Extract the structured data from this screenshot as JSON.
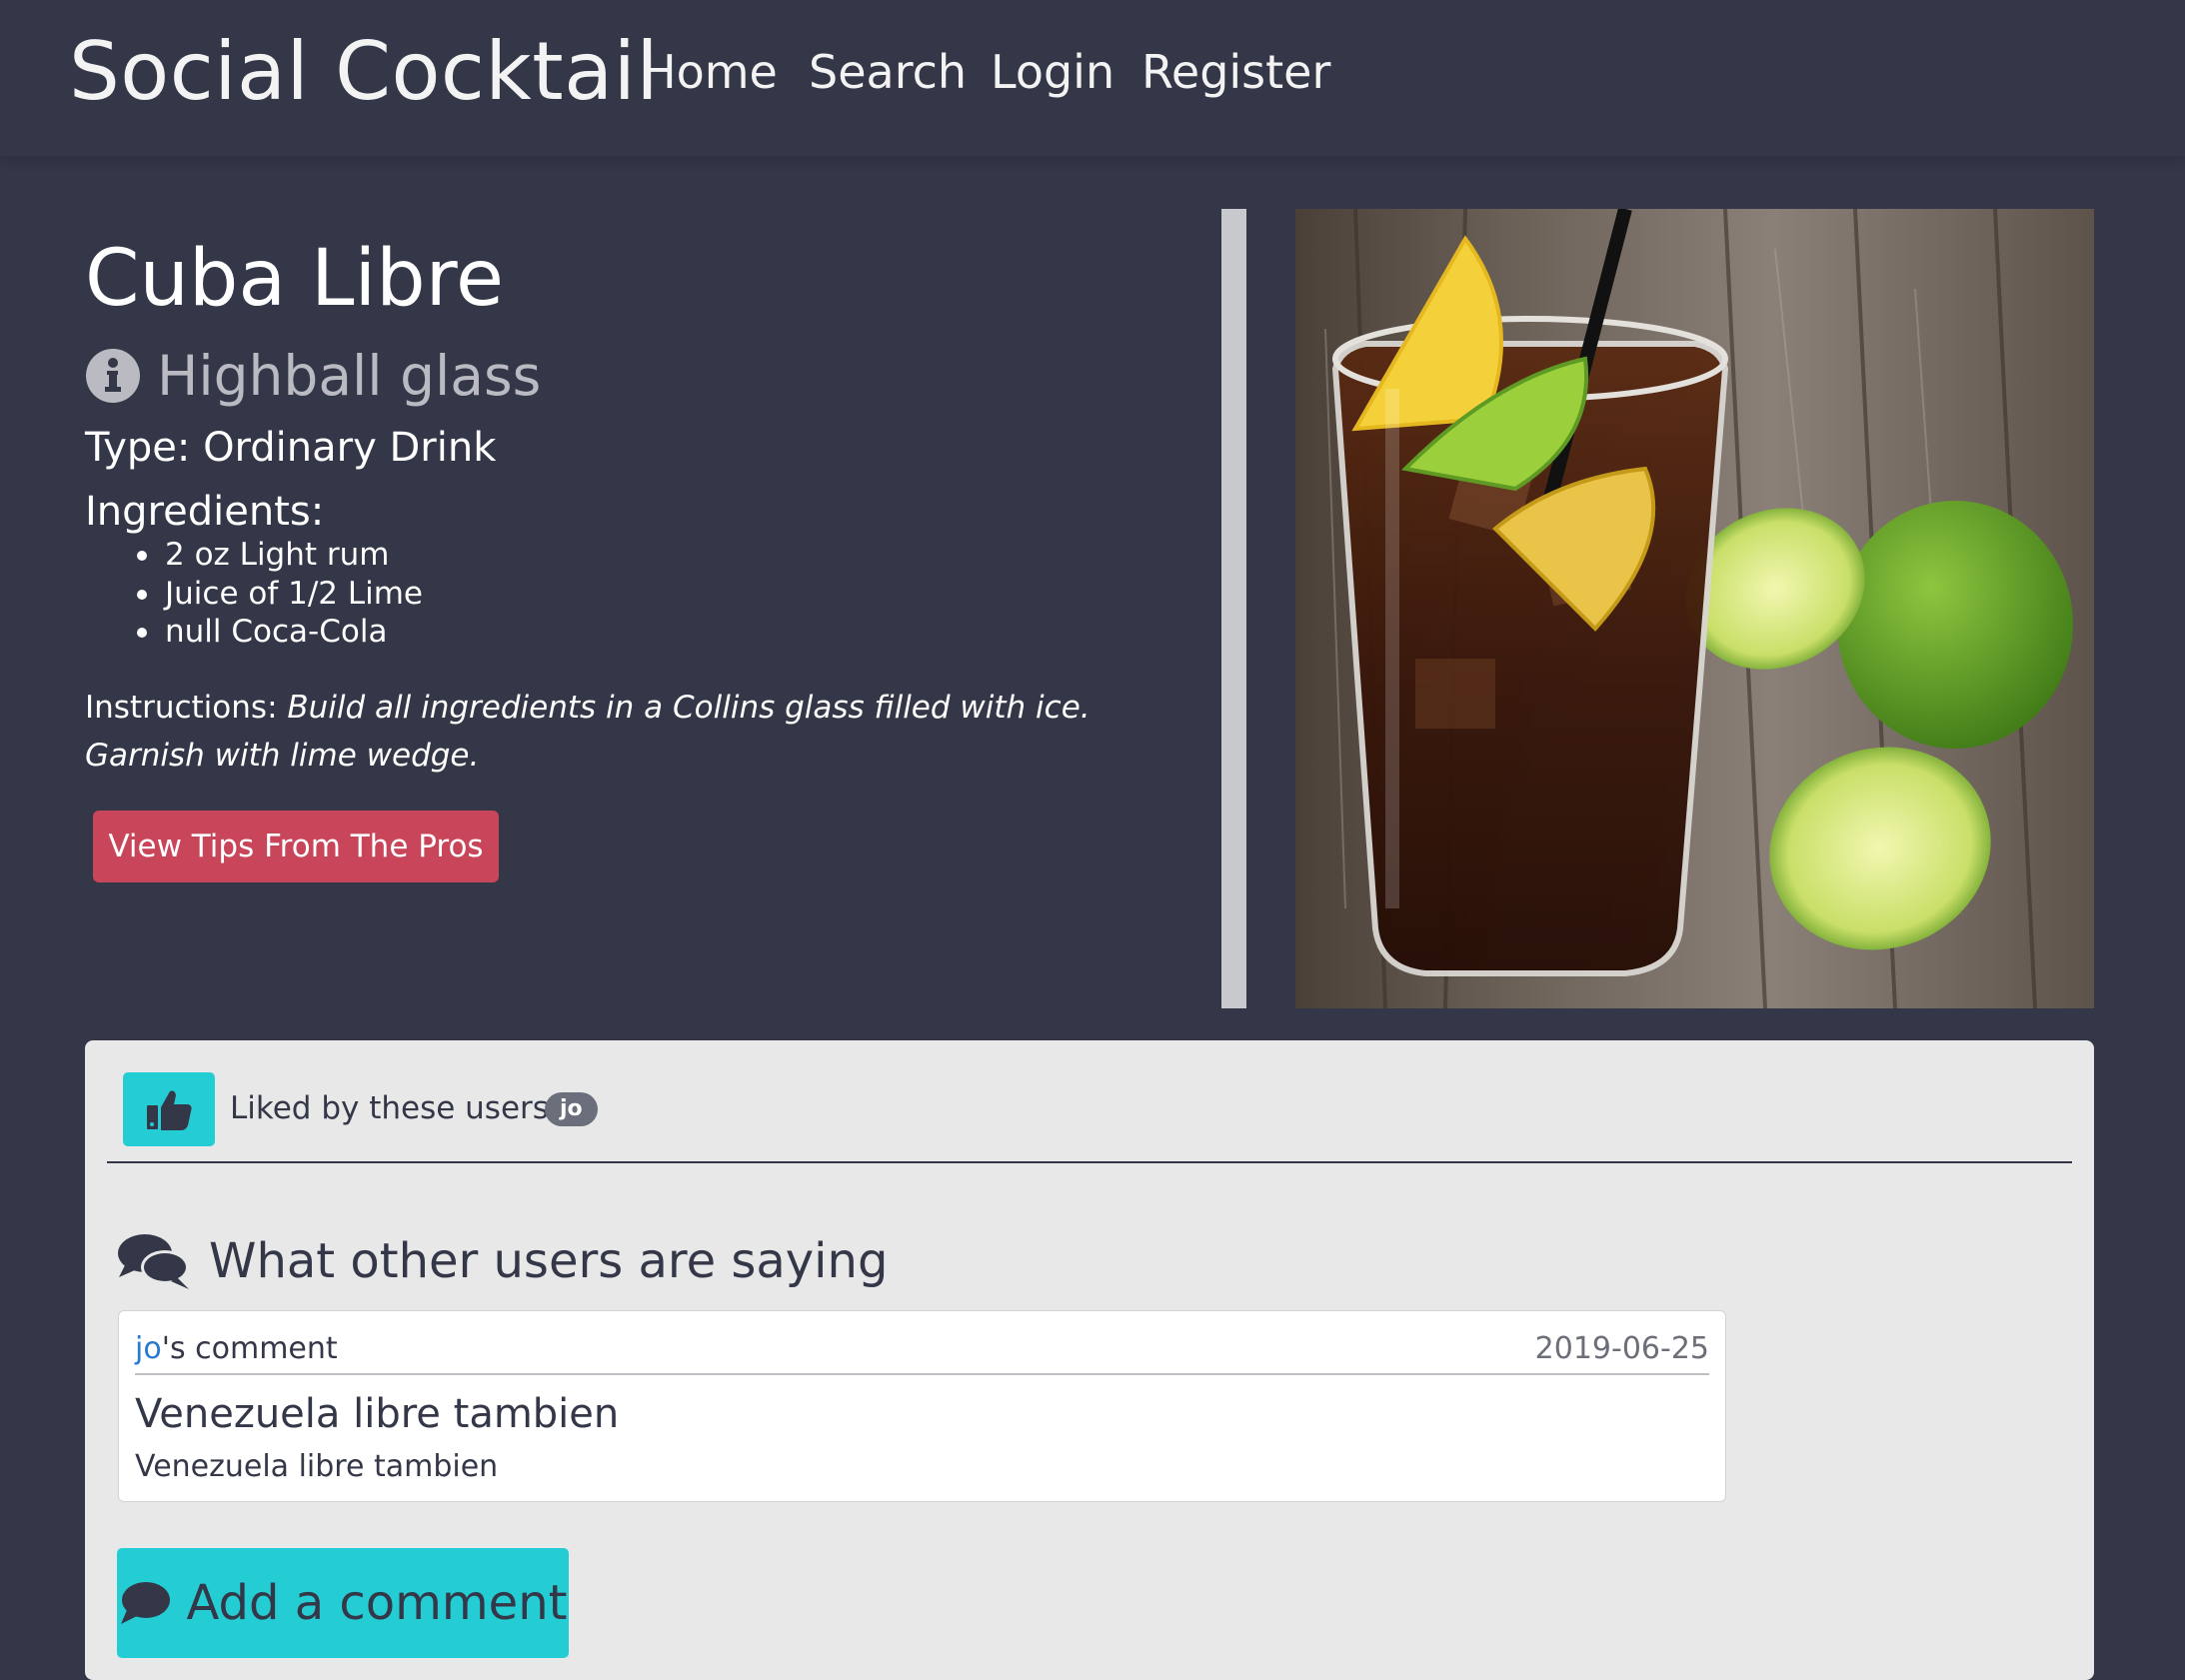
{
  "nav": {
    "brand": "Social Cocktail",
    "links": [
      "Home",
      "Search",
      "Login",
      "Register"
    ]
  },
  "drink": {
    "name": "Cuba Libre",
    "glass": "Highball glass",
    "type_line": "Type: Ordinary Drink",
    "ingredients_heading": "Ingredients:",
    "ingredients": [
      "2 oz Light rum",
      "Juice of 1/2 Lime",
      "null Coca-Cola"
    ],
    "instructions_label": "Instructions:",
    "instructions_text": "Build all ingredients in a Collins glass filled with ice. Garnish with lime wedge.",
    "tips_button": "View Tips From The Pros"
  },
  "likes": {
    "label": "Liked by these users:",
    "users": [
      "jo"
    ]
  },
  "comments": {
    "heading": "What other users are saying",
    "items": [
      {
        "user": "jo",
        "suffix": "'s comment",
        "date": "2019-06-25",
        "title": "Venezuela libre tambien",
        "body": "Venezuela libre tambien"
      }
    ],
    "add_button": "Add a comment"
  },
  "colors": {
    "background": "#343747",
    "accent_teal": "#24cdd4",
    "tips_button": "#c94559",
    "card": "#e8e8e8",
    "link": "#2a7bd0"
  }
}
